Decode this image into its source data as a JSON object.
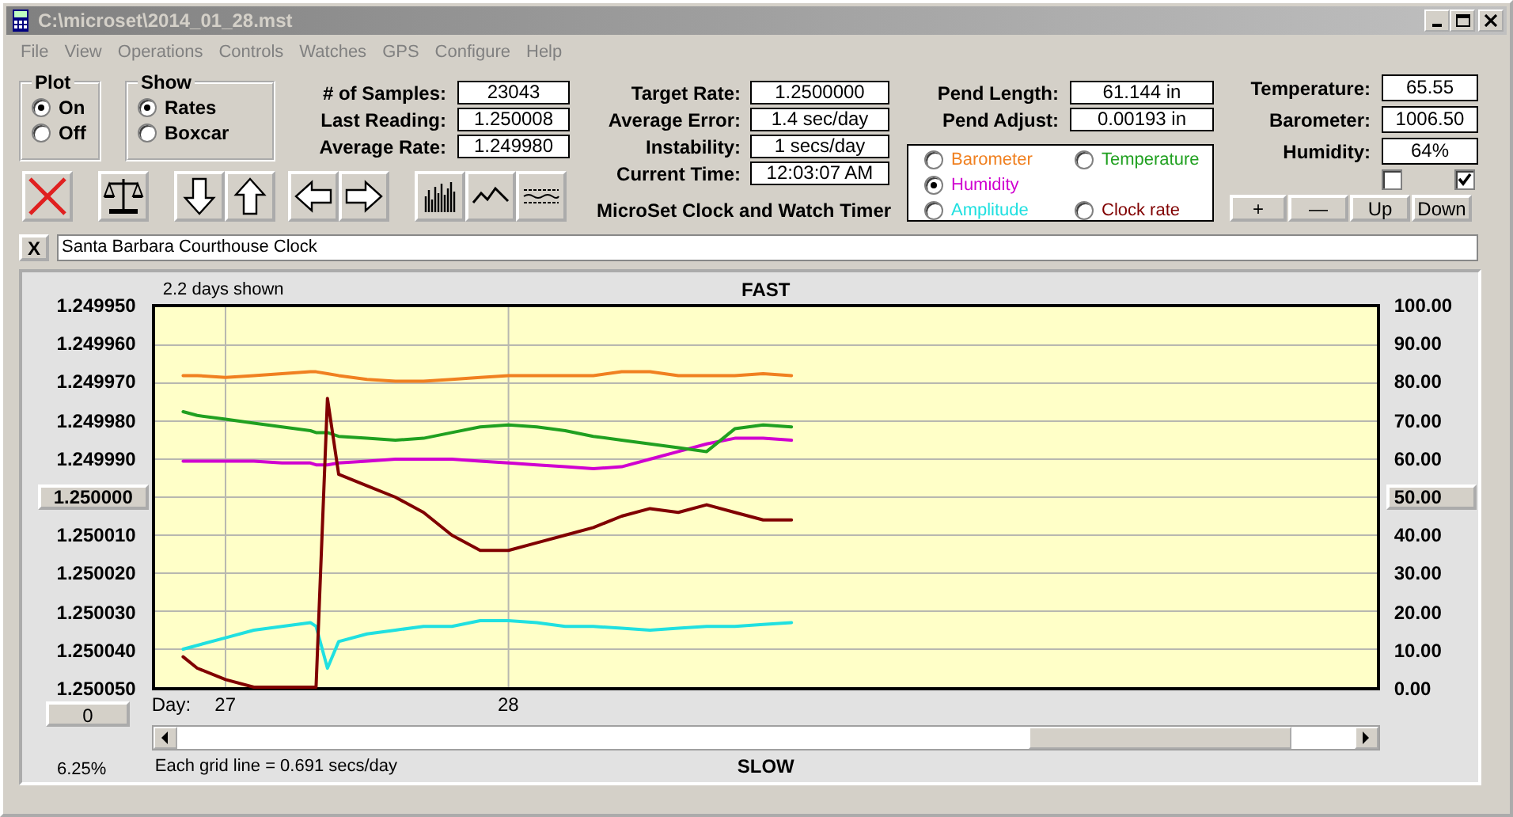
{
  "window": {
    "title": "C:\\microset\\2014_01_28.mst"
  },
  "menu": [
    "File",
    "View",
    "Operations",
    "Controls",
    "Watches",
    "GPS",
    "Configure",
    "Help"
  ],
  "plot_group": {
    "title": "Plot",
    "options": [
      {
        "label": "On",
        "selected": true
      },
      {
        "label": "Off",
        "selected": false
      }
    ]
  },
  "show_group": {
    "title": "Show",
    "options": [
      {
        "label": "Rates",
        "selected": true
      },
      {
        "label": "Boxcar",
        "selected": false
      }
    ]
  },
  "readings": [
    {
      "label": "# of Samples:",
      "value": "23043"
    },
    {
      "label": "Last Reading:",
      "value": "1.250008"
    },
    {
      "label": "Average Rate:",
      "value": "1.249980"
    }
  ],
  "rates": [
    {
      "label": "Target Rate:",
      "value": "1.2500000"
    },
    {
      "label": "Average Error:",
      "value": "1.4 sec/day"
    },
    {
      "label": "Instability:",
      "value": "1 secs/day"
    },
    {
      "label": "Current Time:",
      "value": "12:03:07 AM"
    }
  ],
  "app_title": "MicroSet Clock and Watch Timer",
  "pendulum": [
    {
      "label": "Pend Length:",
      "value": "61.144 in"
    },
    {
      "label": "Pend Adjust:",
      "value": "0.00193 in"
    }
  ],
  "plot_select": [
    {
      "selected": false
    },
    {
      "selected": true
    },
    {
      "selected": false
    },
    {
      "selected": false
    },
    {
      "selected": false
    }
  ],
  "environment": [
    {
      "label": "Temperature:",
      "value": "65.55"
    },
    {
      "label": "Barometer:",
      "value": "1006.50"
    },
    {
      "label": "Humidity:",
      "value": "64%"
    }
  ],
  "env_checkboxes": [
    {
      "checked": false
    },
    {
      "checked": true
    }
  ],
  "env_buttons": [
    "+",
    "—",
    "Up",
    "Down"
  ],
  "clock_name": {
    "clear_button": "X",
    "value": "Santa Barbara Courthouse Clock"
  },
  "chart": {
    "days_shown": "2.2 days shown",
    "top_label": "FAST",
    "bottom_label": "SLOW",
    "day_label": "Day:",
    "offset_button": "0",
    "zoom_reading": "6.25%",
    "grid_note": "Each grid line = 0.691 secs/day",
    "left_axis": [
      {
        "label": "1.249950",
        "kind": "label"
      },
      {
        "label": "1.249960",
        "kind": "label"
      },
      {
        "label": "1.249970",
        "kind": "label"
      },
      {
        "label": "1.249980",
        "kind": "label"
      },
      {
        "label": "1.249990",
        "kind": "label"
      },
      {
        "label": "1.250000",
        "kind": "button"
      },
      {
        "label": "1.250010",
        "kind": "label"
      },
      {
        "label": "1.250020",
        "kind": "label"
      },
      {
        "label": "1.250030",
        "kind": "label"
      },
      {
        "label": "1.250040",
        "kind": "label"
      },
      {
        "label": "1.250050",
        "kind": "label"
      }
    ],
    "chart_data": {
      "type": "line",
      "xlim": [
        26.74,
        31.08
      ],
      "ylim": [
        0,
        100
      ],
      "grid": true,
      "xticks": [
        {
          "value": 27,
          "label": "27"
        },
        {
          "value": 28,
          "label": "28"
        }
      ],
      "yticks": [
        {
          "value": 100,
          "label": "100.00"
        },
        {
          "value": 90,
          "label": "90.00"
        },
        {
          "value": 80,
          "label": "80.00"
        },
        {
          "value": 70,
          "label": "70.00"
        },
        {
          "value": 60,
          "label": "60.00"
        },
        {
          "value": 50,
          "label": "50.00"
        },
        {
          "value": 40,
          "label": "40.00"
        },
        {
          "value": 30,
          "label": "30.00"
        },
        {
          "value": 20,
          "label": "20.00"
        },
        {
          "value": 10,
          "label": "10.00"
        },
        {
          "value": 0,
          "label": "0.00"
        }
      ],
      "x": [
        26.85,
        26.9,
        27.0,
        27.1,
        27.2,
        27.3,
        27.32,
        27.36,
        27.4,
        27.5,
        27.6,
        27.7,
        27.8,
        27.9,
        28.0,
        28.1,
        28.2,
        28.3,
        28.4,
        28.5,
        28.6,
        28.7,
        28.8,
        28.9,
        29.0
      ],
      "series": [
        {
          "name": "Barometer",
          "color": "#f08020",
          "values": [
            82,
            82,
            81.5,
            82,
            82.5,
            83,
            83,
            82.5,
            82,
            81,
            80.5,
            80.5,
            81,
            81.5,
            82,
            82,
            82,
            82,
            83,
            83,
            82,
            82,
            82,
            82.5,
            82
          ]
        },
        {
          "name": "Humidity",
          "color": "#d000d0",
          "values": [
            59.5,
            59.5,
            59.5,
            59.5,
            59,
            59,
            58.5,
            58.5,
            59,
            59.5,
            60,
            60,
            60,
            59.5,
            59,
            58.5,
            58,
            57.5,
            58,
            60,
            62,
            64,
            65.5,
            65.5,
            65
          ]
        },
        {
          "name": "Amplitude",
          "color": "#20e0e0",
          "values": [
            10,
            11,
            13,
            15,
            16,
            17,
            16,
            5,
            12,
            14,
            15,
            16,
            16,
            17.5,
            17.5,
            17,
            16,
            16,
            15.5,
            15,
            15.5,
            16,
            16,
            16.5,
            17
          ]
        },
        {
          "name": "Temperature",
          "color": "#20a020",
          "values": [
            72.5,
            71.5,
            70.5,
            69.5,
            68.5,
            67.5,
            67,
            67,
            66,
            65.5,
            65,
            65.5,
            67,
            68.5,
            69,
            68.5,
            67.5,
            66,
            65,
            64,
            63,
            62,
            68,
            69,
            68.5
          ]
        },
        {
          "name": "Clock rate",
          "color": "#800000",
          "values": [
            8,
            5,
            2,
            0,
            0,
            0,
            0,
            76,
            56,
            53,
            50,
            46,
            40,
            36,
            36,
            38,
            40,
            42,
            45,
            47,
            46,
            48,
            46,
            44,
            44
          ]
        }
      ]
    }
  }
}
